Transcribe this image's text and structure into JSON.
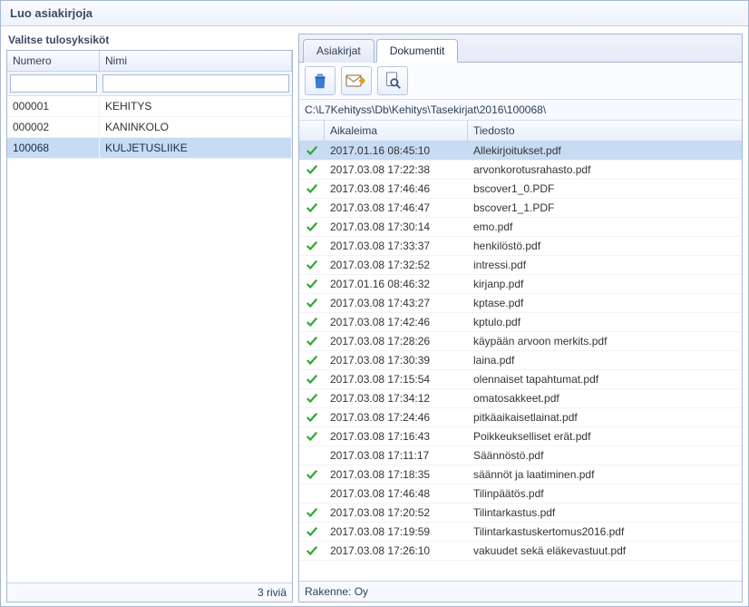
{
  "window": {
    "title": "Luo asiakirjoja"
  },
  "left": {
    "title": "Valitse tulosyksiköt",
    "columns": {
      "num": "Numero",
      "name": "Nimi"
    },
    "filter": {
      "num": "",
      "name": ""
    },
    "rows": [
      {
        "num": "000001",
        "name": "KEHITYS",
        "selected": false
      },
      {
        "num": "000002",
        "name": "KANINKOLO",
        "selected": false
      },
      {
        "num": "100068",
        "name": "KULJETUSLIIKE",
        "selected": true
      }
    ],
    "footer": "3 riviä"
  },
  "right": {
    "tabs": [
      {
        "label": "Asiakirjat",
        "active": false
      },
      {
        "label": "Dokumentit",
        "active": true
      }
    ],
    "toolbar": {
      "icons": {
        "delete": "trash-icon",
        "send": "send-icon",
        "preview": "magnify-icon"
      }
    },
    "path_parts": [
      "C:",
      "L7Kehityss",
      "Db",
      "Kehitys",
      "Tasekirjat",
      "2016",
      "100068",
      ""
    ],
    "doc_columns": {
      "time": "Aikaleima",
      "file": "Tiedosto"
    },
    "docs": [
      {
        "checked": true,
        "time": "2017.01.16 08:45:10",
        "file": "Allekirjoitukset.pdf",
        "selected": true
      },
      {
        "checked": true,
        "time": "2017.03.08 17:22:38",
        "file": "arvonkorotusrahasto.pdf"
      },
      {
        "checked": true,
        "time": "2017.03.08 17:46:46",
        "file": "bscover1_0.PDF"
      },
      {
        "checked": true,
        "time": "2017.03.08 17:46:47",
        "file": "bscover1_1.PDF"
      },
      {
        "checked": true,
        "time": "2017.03.08 17:30:14",
        "file": "emo.pdf"
      },
      {
        "checked": true,
        "time": "2017.03.08 17:33:37",
        "file": "henkilöstö.pdf"
      },
      {
        "checked": true,
        "time": "2017.03.08 17:32:52",
        "file": "intressi.pdf"
      },
      {
        "checked": true,
        "time": "2017.01.16 08:46:32",
        "file": "kirjanp.pdf"
      },
      {
        "checked": true,
        "time": "2017.03.08 17:43:27",
        "file": "kptase.pdf"
      },
      {
        "checked": true,
        "time": "2017.03.08 17:42:46",
        "file": "kptulo.pdf"
      },
      {
        "checked": true,
        "time": "2017.03.08 17:28:26",
        "file": "käypään arvoon merkits.pdf"
      },
      {
        "checked": true,
        "time": "2017.03.08 17:30:39",
        "file": "laina.pdf"
      },
      {
        "checked": true,
        "time": "2017.03.08 17:15:54",
        "file": "olennaiset tapahtumat.pdf"
      },
      {
        "checked": true,
        "time": "2017.03.08 17:34:12",
        "file": "omatosakkeet.pdf"
      },
      {
        "checked": true,
        "time": "2017.03.08 17:24:46",
        "file": "pitkäaikaisetlainat.pdf"
      },
      {
        "checked": true,
        "time": "2017.03.08 17:16:43",
        "file": "Poikkeukselliset erät.pdf"
      },
      {
        "checked": false,
        "time": "2017.03.08 17:11:17",
        "file": "Säännöstö.pdf"
      },
      {
        "checked": true,
        "time": "2017.03.08 17:18:35",
        "file": "säännöt ja laatiminen.pdf"
      },
      {
        "checked": false,
        "time": "2017.03.08 17:46:48",
        "file": "Tilinpäätös.pdf"
      },
      {
        "checked": true,
        "time": "2017.03.08 17:20:52",
        "file": "Tilintarkastus.pdf"
      },
      {
        "checked": true,
        "time": "2017.03.08 17:19:59",
        "file": "Tilintarkastuskertomus2016.pdf"
      },
      {
        "checked": true,
        "time": "2017.03.08 17:26:10",
        "file": "vakuudet sekä eläkevastuut.pdf"
      }
    ],
    "status": "Rakenne: Oy"
  }
}
